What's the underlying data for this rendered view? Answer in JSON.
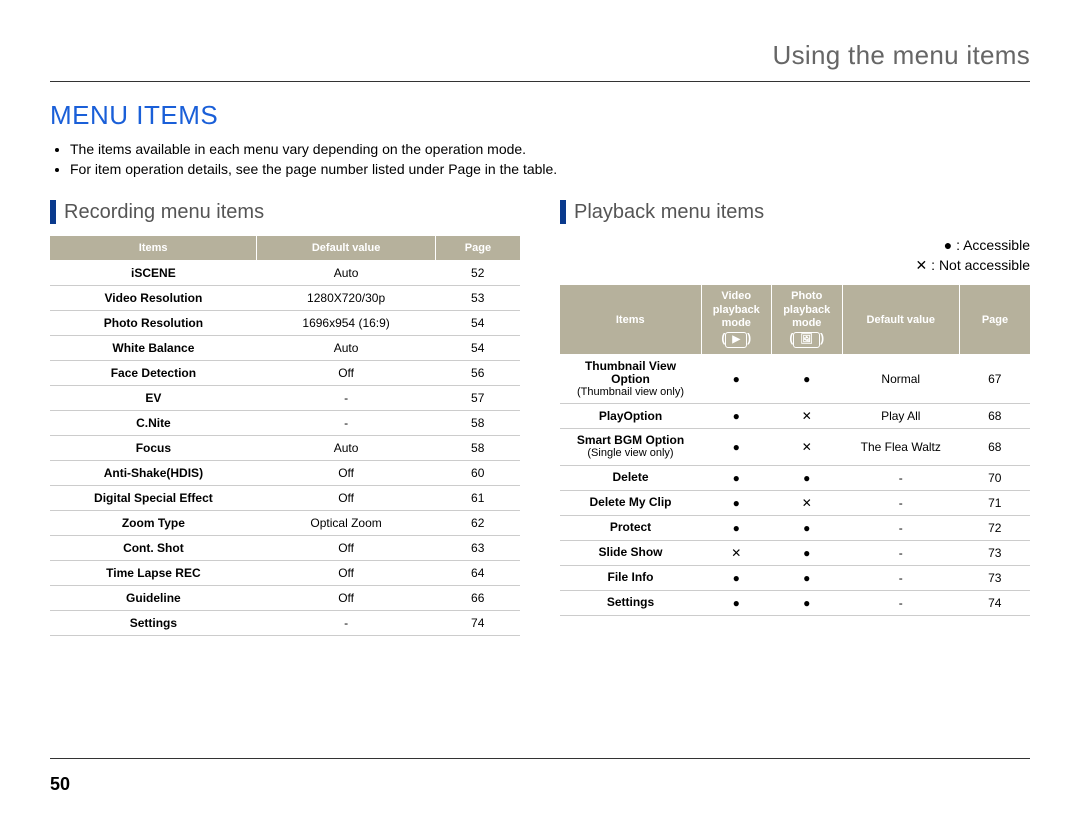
{
  "running_head": "Using the menu items",
  "title": "MENU ITEMS",
  "bullets": [
    "The items available in each menu vary depending on the operation mode.",
    "For item operation details, see the page number listed under Page in the table."
  ],
  "page_number": "50",
  "recording": {
    "heading": "Recording menu items",
    "headers": {
      "items": "Items",
      "default": "Default value",
      "page": "Page"
    },
    "rows": [
      {
        "item": "iSCENE",
        "default": "Auto",
        "page": "52"
      },
      {
        "item": "Video Resolution",
        "default": "1280X720/30p",
        "page": "53"
      },
      {
        "item": "Photo Resolution",
        "default": "1696x954 (16:9)",
        "page": "54"
      },
      {
        "item": "White Balance",
        "default": "Auto",
        "page": "54"
      },
      {
        "item": "Face Detection",
        "default": "Off",
        "page": "56"
      },
      {
        "item": "EV",
        "default": "-",
        "page": "57"
      },
      {
        "item": "C.Nite",
        "default": "-",
        "page": "58"
      },
      {
        "item": "Focus",
        "default": "Auto",
        "page": "58"
      },
      {
        "item": "Anti-Shake(HDIS)",
        "default": "Off",
        "page": "60"
      },
      {
        "item": "Digital Special Effect",
        "default": "Off",
        "page": "61"
      },
      {
        "item": "Zoom Type",
        "default": "Optical Zoom",
        "page": "62"
      },
      {
        "item": "Cont. Shot",
        "default": "Off",
        "page": "63"
      },
      {
        "item": "Time Lapse REC",
        "default": "Off",
        "page": "64"
      },
      {
        "item": "Guideline",
        "default": "Off",
        "page": "66"
      },
      {
        "item": "Settings",
        "default": "-",
        "page": "74"
      }
    ]
  },
  "playback": {
    "heading": "Playback menu items",
    "legend": {
      "acc": "● : Accessible",
      "nacc": "✕ : Not accessible"
    },
    "headers": {
      "items": "Items",
      "video_l1": "Video",
      "video_l2": "playback",
      "video_l3": "mode",
      "photo_l1": "Photo",
      "photo_l2": "playback",
      "photo_l3": "mode",
      "default": "Default value",
      "page": "Page"
    },
    "icon_video": "▶",
    "icon_photo": "🖼",
    "rows": [
      {
        "item_main": "Thumbnail View Option",
        "item_sub": "(Thumbnail view only)",
        "video": "●",
        "photo": "●",
        "default": "Normal",
        "page": "67"
      },
      {
        "item_main": "PlayOption",
        "item_sub": "",
        "video": "●",
        "photo": "✕",
        "default": "Play All",
        "page": "68"
      },
      {
        "item_main": "Smart BGM Option",
        "item_sub": "(Single view only)",
        "video": "●",
        "photo": "✕",
        "default": "The Flea Waltz",
        "page": "68"
      },
      {
        "item_main": "Delete",
        "item_sub": "",
        "video": "●",
        "photo": "●",
        "default": "-",
        "page": "70"
      },
      {
        "item_main": "Delete My Clip",
        "item_sub": "",
        "video": "●",
        "photo": "✕",
        "default": "-",
        "page": "71"
      },
      {
        "item_main": "Protect",
        "item_sub": "",
        "video": "●",
        "photo": "●",
        "default": "-",
        "page": "72"
      },
      {
        "item_main": "Slide Show",
        "item_sub": "",
        "video": "✕",
        "photo": "●",
        "default": "-",
        "page": "73"
      },
      {
        "item_main": "File Info",
        "item_sub": "",
        "video": "●",
        "photo": "●",
        "default": "-",
        "page": "73"
      },
      {
        "item_main": "Settings",
        "item_sub": "",
        "video": "●",
        "photo": "●",
        "default": "-",
        "page": "74"
      }
    ]
  }
}
